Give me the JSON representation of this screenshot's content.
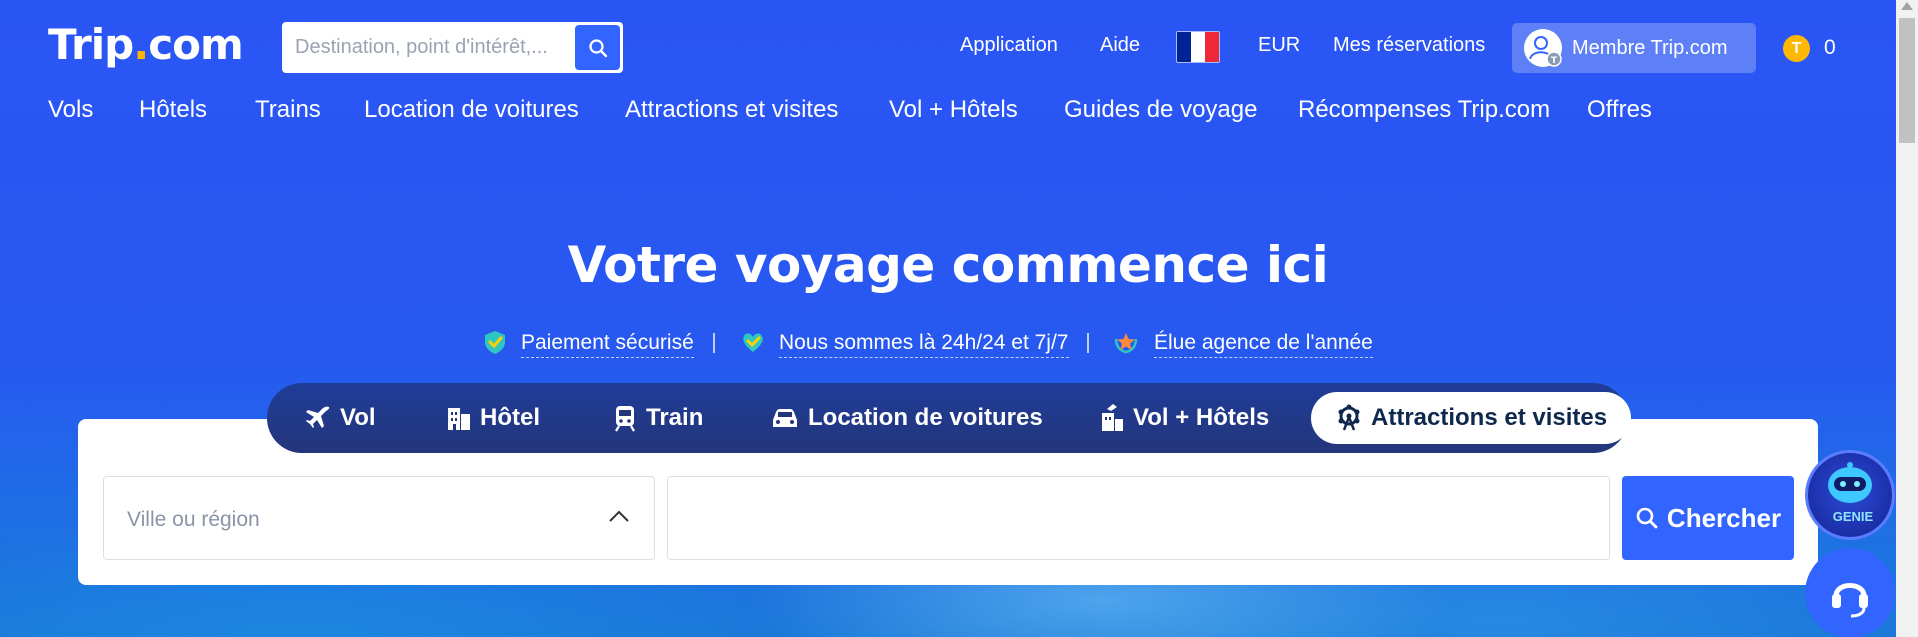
{
  "header": {
    "logo_main": "Trip",
    "logo_dot": ".",
    "logo_suffix": "com",
    "search_placeholder": "Destination, point d'intérêt,...",
    "links": {
      "application": "Application",
      "help": "Aide",
      "currency": "EUR",
      "bookings": "Mes réservations"
    },
    "member_label": "Membre Trip.com",
    "coin_symbol": "T",
    "coin_count": "0"
  },
  "nav": {
    "items": [
      "Vols",
      "Hôtels",
      "Trains",
      "Location de voitures",
      "Attractions et visites",
      "Vol + Hôtels",
      "Guides de voyage",
      "Récompenses Trip.com",
      "Offres"
    ]
  },
  "hero": {
    "title": "Votre voyage commence ici",
    "badges": [
      "Paiement sécurisé",
      "Nous sommes là 24h/24 et 7j/7",
      "Élue agence de l'année"
    ]
  },
  "search": {
    "tabs": [
      "Vol",
      "Hôtel",
      "Train",
      "Location de voitures",
      "Vol + Hôtels",
      "Attractions et visites"
    ],
    "active_tab": "Attractions et visites",
    "city_placeholder": "Ville ou région",
    "keyword_value": "",
    "submit_label": "Chercher"
  },
  "floating": {
    "genie_label": "GENIE"
  },
  "colors": {
    "brand_blue": "#3264ff",
    "background": "#2758f0",
    "coin": "#ffb800",
    "flag": [
      "#002395",
      "#ffffff",
      "#ed2939"
    ]
  }
}
